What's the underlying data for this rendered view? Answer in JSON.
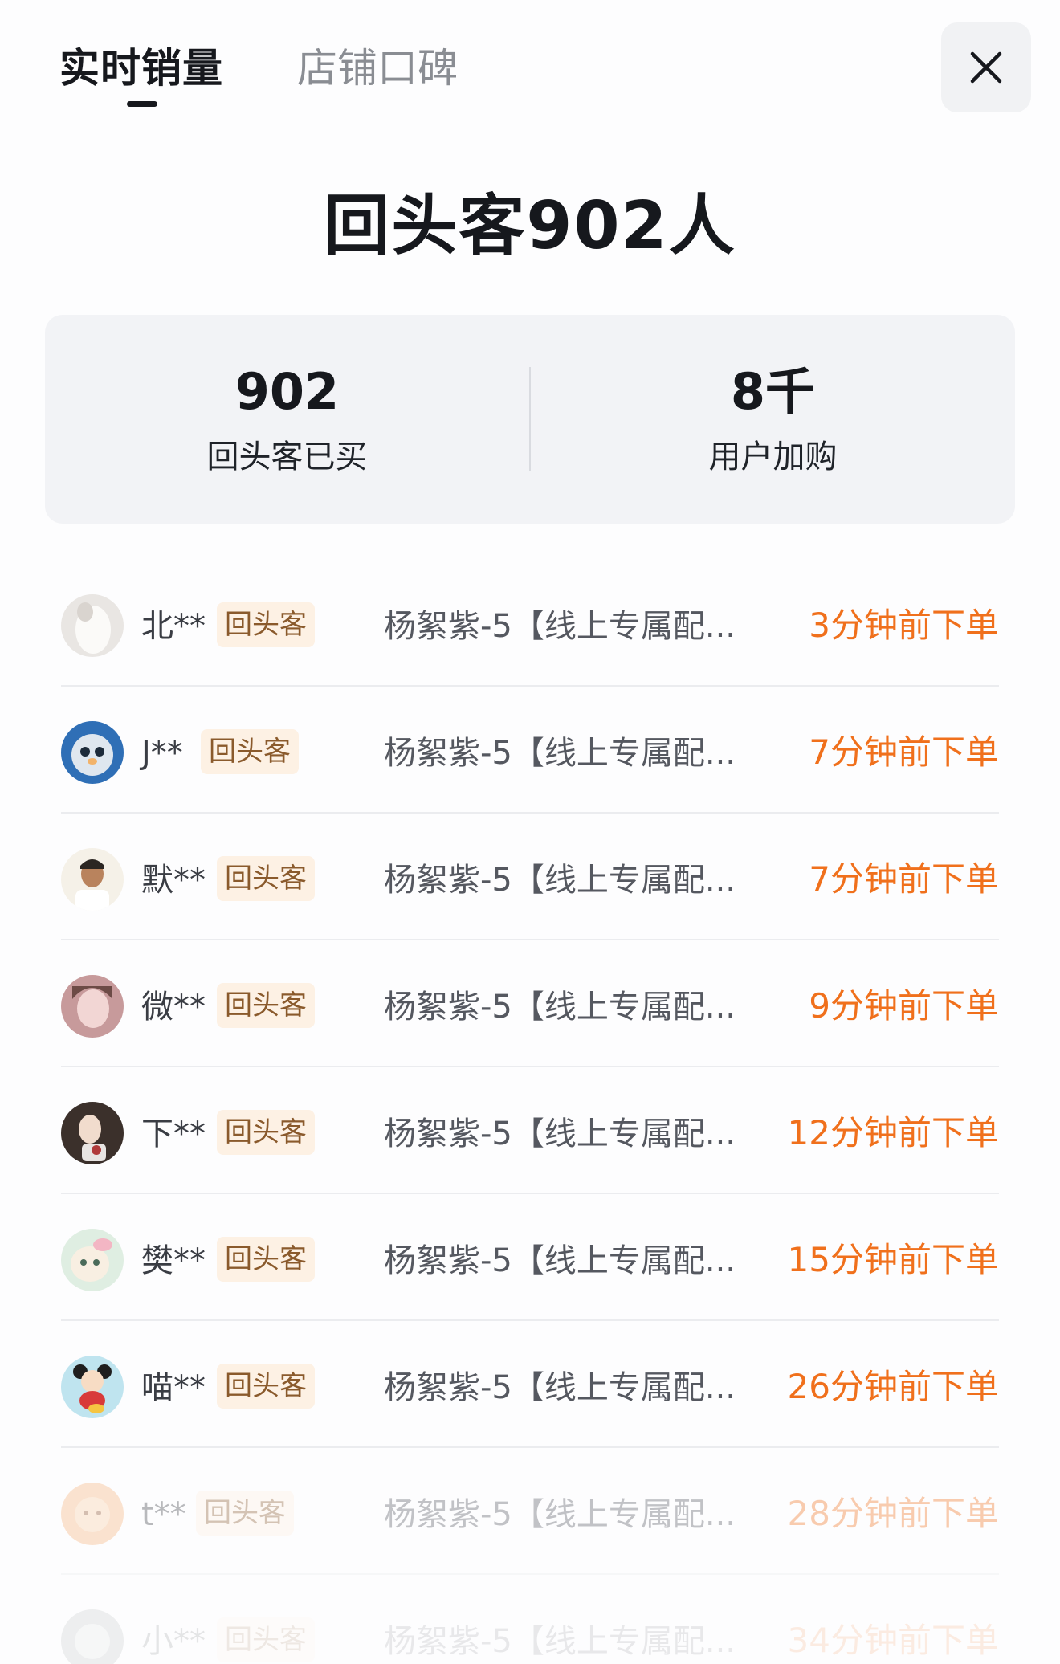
{
  "tabs": [
    {
      "label": "实时销量",
      "active": true
    },
    {
      "label": "店铺口碑",
      "active": false
    }
  ],
  "close_icon": "close-icon",
  "headline": "回头客902人",
  "stats": [
    {
      "value": "902",
      "label": "回头客已买"
    },
    {
      "value": "8千",
      "label": "用户加购"
    }
  ],
  "colors": {
    "accent": "#f0701c",
    "badge_bg": "#fdf1e4",
    "badge_text": "#8a5a2c",
    "card_bg": "#f2f3f6"
  },
  "orders": [
    {
      "name": "北**",
      "badge": "回头客",
      "product": "杨絮紫-5【线上专属配...",
      "time": "3分钟前下单",
      "avatar": "avatar-white"
    },
    {
      "name": "J**",
      "badge": "回头客",
      "product": "杨絮紫-5【线上专属配...",
      "time": "7分钟前下单",
      "avatar": "avatar-seal"
    },
    {
      "name": "默**",
      "badge": "回头客",
      "product": "杨絮紫-5【线上专属配...",
      "time": "7分钟前下单",
      "avatar": "avatar-man"
    },
    {
      "name": "微**",
      "badge": "回头客",
      "product": "杨絮紫-5【线上专属配...",
      "time": "9分钟前下单",
      "avatar": "avatar-girl"
    },
    {
      "name": "下**",
      "badge": "回头客",
      "product": "杨絮紫-5【线上专属配...",
      "time": "12分钟前下单",
      "avatar": "avatar-woman"
    },
    {
      "name": "樊**",
      "badge": "回头客",
      "product": "杨絮紫-5【线上专属配...",
      "time": "15分钟前下单",
      "avatar": "avatar-cartoon"
    },
    {
      "name": "喵**",
      "badge": "回头客",
      "product": "杨絮紫-5【线上专属配...",
      "time": "26分钟前下单",
      "avatar": "avatar-mouse"
    },
    {
      "name": "t**",
      "badge": "回头客",
      "product": "杨絮紫-5【线上专属配...",
      "time": "28分钟前下单",
      "avatar": "avatar-orange"
    },
    {
      "name": "小**",
      "badge": "回头客",
      "product": "杨絮紫-5【线上专属配...",
      "time": "34分钟前下单",
      "avatar": "avatar-gray"
    }
  ]
}
